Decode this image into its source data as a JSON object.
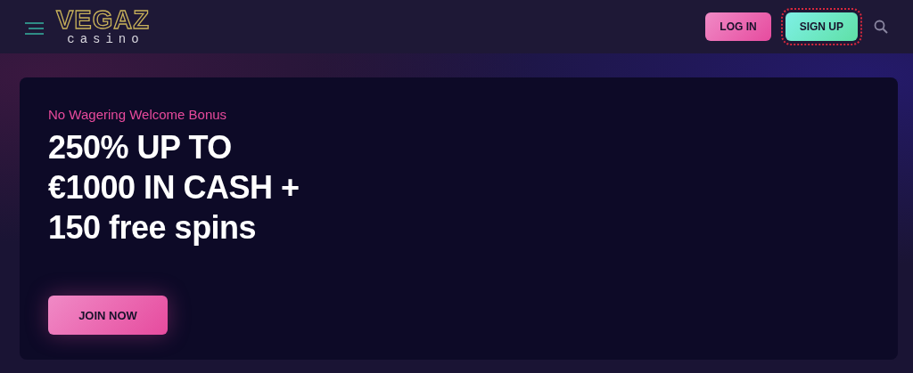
{
  "header": {
    "logo": {
      "title": "VEGAZ",
      "subtitle": "casino"
    },
    "buttons": [
      {
        "label": "LOG IN",
        "kind": "login",
        "focused": false
      },
      {
        "label": "SIGN UP",
        "kind": "signup",
        "focused": true
      }
    ]
  },
  "hero": {
    "eyebrow": "No Wagering Welcome Bonus",
    "headline": [
      "250% UP TO",
      "€1000 IN CASH +",
      "150 free spins"
    ],
    "cta": "JOIN NOW"
  }
}
